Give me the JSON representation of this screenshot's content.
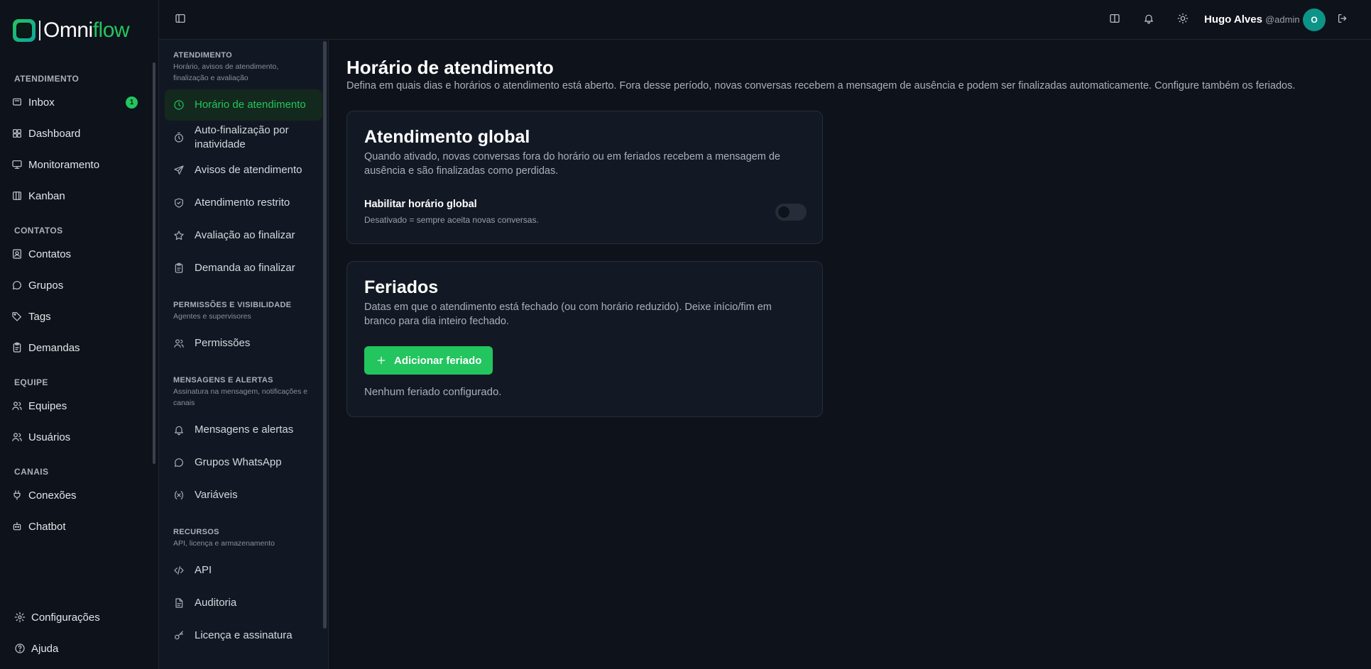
{
  "brand": {
    "logo_text_a": "Omni",
    "logo_text_b": "flow"
  },
  "leftnav": {
    "sections": [
      {
        "title": "ATENDIMENTO",
        "items": [
          {
            "label": "Inbox",
            "icon": "inbox-icon",
            "badge": "1"
          },
          {
            "label": "Dashboard",
            "icon": "dashboard-icon"
          },
          {
            "label": "Monitoramento",
            "icon": "monitor-icon"
          },
          {
            "label": "Kanban",
            "icon": "kanban-icon"
          }
        ]
      },
      {
        "title": "CONTATOS",
        "items": [
          {
            "label": "Contatos",
            "icon": "contact-icon"
          },
          {
            "label": "Grupos",
            "icon": "chat-bubble-icon"
          },
          {
            "label": "Tags",
            "icon": "tag-icon"
          },
          {
            "label": "Demandas",
            "icon": "clipboard-icon"
          }
        ]
      },
      {
        "title": "EQUIPE",
        "items": [
          {
            "label": "Equipes",
            "icon": "users-icon"
          },
          {
            "label": "Usuários",
            "icon": "users-icon"
          }
        ]
      },
      {
        "title": "CANAIS",
        "items": [
          {
            "label": "Conexões",
            "icon": "plug-icon"
          },
          {
            "label": "Chatbot",
            "icon": "bot-icon"
          }
        ]
      }
    ],
    "bottom": [
      {
        "label": "Configurações",
        "icon": "gear-icon"
      },
      {
        "label": "Ajuda",
        "icon": "help-icon"
      }
    ]
  },
  "subnav": {
    "groups": [
      {
        "title": "ATENDIMENTO",
        "desc": "Horário, avisos de atendimento, finalização e avaliação",
        "items": [
          {
            "label": "Horário de atendimento",
            "icon": "clock-icon",
            "active": true
          },
          {
            "label": "Auto-finalização por inatividade",
            "icon": "timer-icon"
          },
          {
            "label": "Avisos de atendimento",
            "icon": "send-icon"
          },
          {
            "label": "Atendimento restrito",
            "icon": "shield-icon"
          },
          {
            "label": "Avaliação ao finalizar",
            "icon": "star-icon"
          },
          {
            "label": "Demanda ao finalizar",
            "icon": "clipboard-icon"
          }
        ]
      },
      {
        "title": "PERMISSÕES E VISIBILIDADE",
        "desc": "Agentes e supervisores",
        "items": [
          {
            "label": "Permissões",
            "icon": "users-icon"
          }
        ]
      },
      {
        "title": "MENSAGENS E ALERTAS",
        "desc": "Assinatura na mensagem, notificações e canais",
        "items": [
          {
            "label": "Mensagens e alertas",
            "icon": "bell-icon"
          },
          {
            "label": "Grupos WhatsApp",
            "icon": "chat-bubble-icon"
          },
          {
            "label": "Variáveis",
            "icon": "variable-icon"
          }
        ]
      },
      {
        "title": "RECURSOS",
        "desc": "API, licença e armazenamento",
        "items": [
          {
            "label": "API",
            "icon": "code-icon"
          },
          {
            "label": "Auditoria",
            "icon": "file-icon"
          },
          {
            "label": "Licença e assinatura",
            "icon": "key-icon"
          }
        ]
      }
    ]
  },
  "topbar": {
    "user_name": "Hugo Alves",
    "user_handle": "@admin",
    "avatar_initial": "O"
  },
  "main": {
    "title": "Horário de atendimento",
    "description": "Defina em quais dias e horários o atendimento está aberto. Fora desse período, novas conversas recebem a mensagem de ausência e podem ser finalizadas automaticamente. Configure também os feriados.",
    "global_card": {
      "title": "Atendimento global",
      "description": "Quando ativado, novas conversas fora do horário ou em feriados recebem a mensagem de ausência e são finalizadas como perdidas.",
      "toggle_label": "Habilitar horário global",
      "toggle_hint": "Desativado = sempre aceita novas conversas.",
      "toggle_on": false
    },
    "holidays_card": {
      "title": "Feriados",
      "description": "Datas em que o atendimento está fechado (ou com horário reduzido). Deixe início/fim em branco para dia inteiro fechado.",
      "add_button": "Adicionar feriado",
      "empty_text": "Nenhum feriado configurado."
    }
  }
}
